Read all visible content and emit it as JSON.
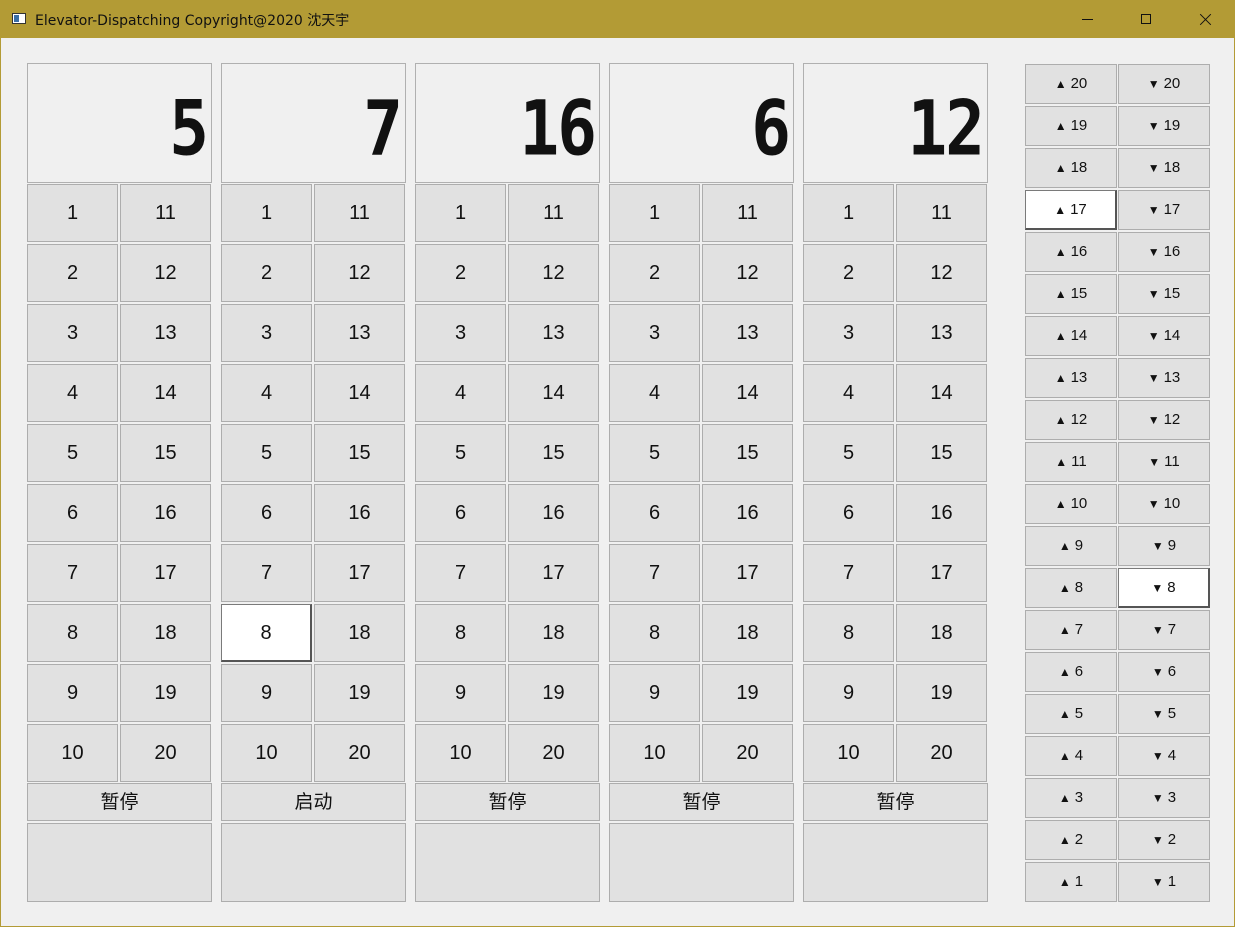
{
  "window": {
    "title": "Elevator-Dispatching Copyright@2020 沈天宇"
  },
  "elevators": [
    {
      "floor": "5",
      "control": "暂停",
      "active_floor": null
    },
    {
      "floor": "7",
      "control": "启动",
      "active_floor": "8"
    },
    {
      "floor": "16",
      "control": "暂停",
      "active_floor": null
    },
    {
      "floor": "6",
      "control": "暂停",
      "active_floor": null
    },
    {
      "floor": "12",
      "control": "暂停",
      "active_floor": null
    }
  ],
  "floor_buttons": [
    "1",
    "2",
    "3",
    "4",
    "5",
    "6",
    "7",
    "8",
    "9",
    "10",
    "11",
    "12",
    "13",
    "14",
    "15",
    "16",
    "17",
    "18",
    "19",
    "20"
  ],
  "hall_calls": {
    "floors": [
      "20",
      "19",
      "18",
      "17",
      "16",
      "15",
      "14",
      "13",
      "12",
      "11",
      "10",
      "9",
      "8",
      "7",
      "6",
      "5",
      "4",
      "3",
      "2",
      "1"
    ],
    "up_symbol": "▲",
    "down_symbol": "▼",
    "active_up": "17",
    "active_down": "8"
  },
  "colors": {
    "titlebar": "#b39b35",
    "button": "#e1e1e1",
    "active": "#ffffff",
    "background": "#f0f0f0"
  }
}
